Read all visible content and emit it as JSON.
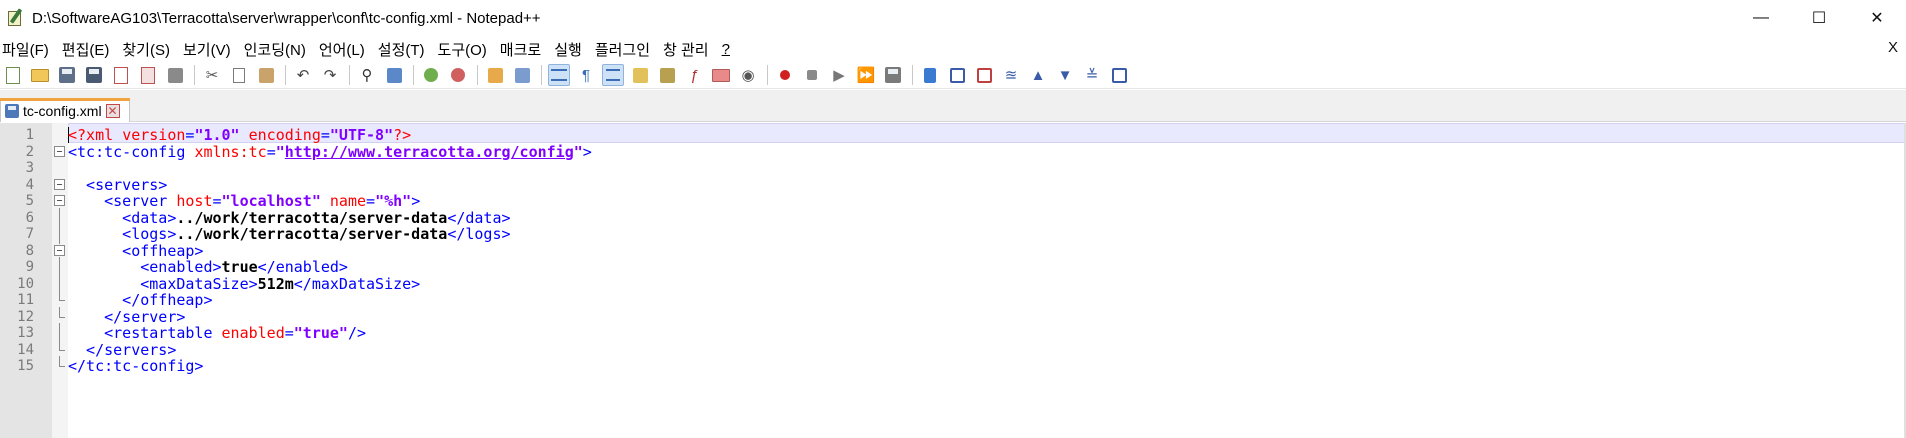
{
  "window": {
    "title": "D:\\SoftwareAG103\\Terracotta\\server\\wrapper\\conf\\tc-config.xml - Notepad++",
    "controls": {
      "minimize": "—",
      "maximize": "☐",
      "close": "✕"
    }
  },
  "menu": {
    "items": [
      "파일(F)",
      "편집(E)",
      "찾기(S)",
      "보기(V)",
      "인코딩(N)",
      "언어(L)",
      "설정(T)",
      "도구(O)",
      "매크로",
      "실행",
      "플러그인",
      "창 관리",
      "?"
    ],
    "close": "X"
  },
  "toolbar": {
    "icons": [
      "new-file-icon",
      "open-file-icon",
      "save-icon",
      "save-all-icon",
      "close-icon",
      "close-all-icon",
      "print-icon",
      "cut-icon",
      "copy-icon",
      "paste-icon",
      "undo-icon",
      "redo-icon",
      "find-icon",
      "replace-icon",
      "zoom-in-icon",
      "zoom-out-icon",
      "sync-vertical-icon",
      "sync-horizontal-icon",
      "word-wrap-icon",
      "show-all-chars-icon",
      "indent-guide-icon",
      "language-udl-icon",
      "document-map-icon",
      "function-list-icon",
      "folder-workspace-icon",
      "monitoring-icon",
      "record-macro-icon",
      "stop-record-icon",
      "playback-macro-icon",
      "run-macro-multiple-icon",
      "save-macro-icon",
      "plugin-1-icon",
      "plugin-2-icon",
      "plugin-3-icon",
      "plugin-4-icon",
      "plugin-5-icon",
      "plugin-6-icon",
      "plugin-7-icon",
      "plugin-8-icon"
    ]
  },
  "tab": {
    "label": "tc-config.xml",
    "close": "✕"
  },
  "editor": {
    "lines": [
      {
        "num": "1",
        "tokens": [
          [
            "decl",
            "<?xml "
          ],
          [
            "attr",
            "version"
          ],
          [
            "tag",
            "="
          ],
          [
            "val",
            "\"1.0\""
          ],
          [
            "tag",
            " "
          ],
          [
            "attr",
            "encoding"
          ],
          [
            "tag",
            "="
          ],
          [
            "val",
            "\"UTF-8\""
          ],
          [
            "decl",
            "?>"
          ]
        ]
      },
      {
        "num": "2",
        "tokens": [
          [
            "tag",
            "<tc:tc-config "
          ],
          [
            "attr",
            "xmlns:tc"
          ],
          [
            "tag",
            "="
          ],
          [
            "val",
            "\""
          ],
          [
            "url",
            "http://www.terracotta.org/config"
          ],
          [
            "val",
            "\""
          ],
          [
            "tag",
            ">"
          ]
        ]
      },
      {
        "num": "3",
        "tokens": []
      },
      {
        "num": "4",
        "tokens": [
          [
            "tag",
            "  <servers>"
          ]
        ]
      },
      {
        "num": "5",
        "tokens": [
          [
            "tag",
            "    <server "
          ],
          [
            "attr",
            "host"
          ],
          [
            "tag",
            "="
          ],
          [
            "val",
            "\"localhost\""
          ],
          [
            "tag",
            " "
          ],
          [
            "attr",
            "name"
          ],
          [
            "tag",
            "="
          ],
          [
            "val",
            "\"%h\""
          ],
          [
            "tag",
            ">"
          ]
        ]
      },
      {
        "num": "6",
        "tokens": [
          [
            "tag",
            "      <data>"
          ],
          [
            "text",
            "../work/terracotta/server-data"
          ],
          [
            "tag",
            "</data>"
          ]
        ]
      },
      {
        "num": "7",
        "tokens": [
          [
            "tag",
            "      <logs>"
          ],
          [
            "text",
            "../work/terracotta/server-data"
          ],
          [
            "tag",
            "</logs>"
          ]
        ]
      },
      {
        "num": "8",
        "tokens": [
          [
            "tag",
            "      <offheap>"
          ]
        ]
      },
      {
        "num": "9",
        "tokens": [
          [
            "tag",
            "        <enabled>"
          ],
          [
            "text",
            "true"
          ],
          [
            "tag",
            "</enabled>"
          ]
        ]
      },
      {
        "num": "10",
        "tokens": [
          [
            "tag",
            "        <maxDataSize>"
          ],
          [
            "text",
            "512m"
          ],
          [
            "tag",
            "</maxDataSize>"
          ]
        ]
      },
      {
        "num": "11",
        "tokens": [
          [
            "tag",
            "      </offheap>"
          ]
        ]
      },
      {
        "num": "12",
        "tokens": [
          [
            "tag",
            "    </server>"
          ]
        ]
      },
      {
        "num": "13",
        "tokens": [
          [
            "tag",
            "    <restartable "
          ],
          [
            "attr",
            "enabled"
          ],
          [
            "tag",
            "="
          ],
          [
            "val",
            "\"true\""
          ],
          [
            "tag",
            "/>"
          ]
        ]
      },
      {
        "num": "14",
        "tokens": [
          [
            "tag",
            "  </servers>"
          ]
        ]
      },
      {
        "num": "15",
        "tokens": [
          [
            "tag",
            "</tc:tc-config>"
          ]
        ]
      }
    ],
    "folds": [
      "",
      "box",
      "",
      "box",
      "box",
      "vline",
      "vline",
      "box",
      "vline",
      "vline",
      "end",
      "end",
      "vline",
      "end",
      "end"
    ]
  },
  "colors": {
    "tag": "#0000ff",
    "attr": "#ff0000",
    "value": "#8000ff",
    "text": "#000000",
    "current_line": "#e8e8ff",
    "gutter": "#e4e4e4",
    "tab_accent": "#f0a33e"
  }
}
